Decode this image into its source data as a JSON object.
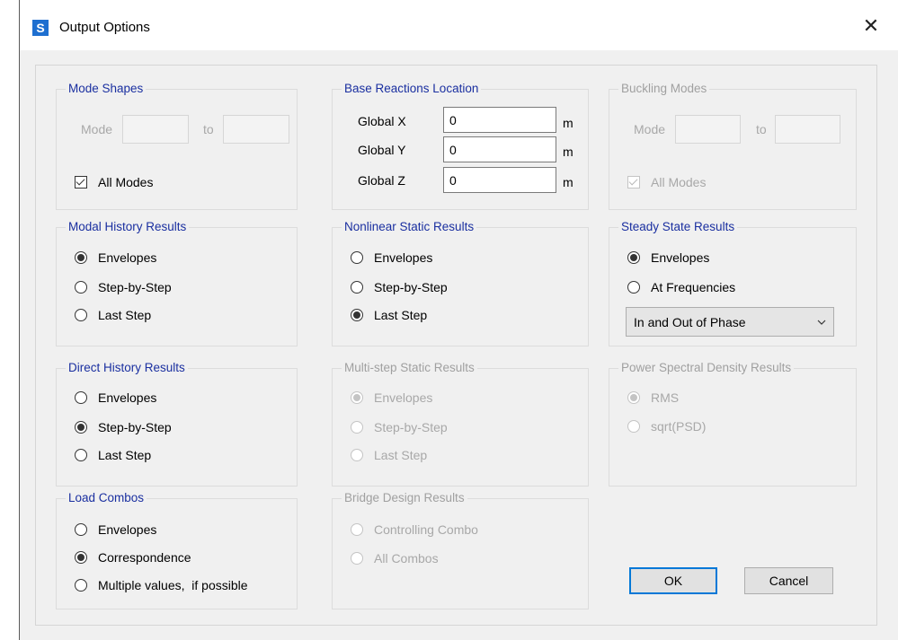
{
  "window": {
    "title": "Output Options",
    "app_icon_letter": "S",
    "close_glyph": "✕"
  },
  "mode_shapes": {
    "title": "Mode Shapes",
    "mode_label": "Mode",
    "to_label": "to",
    "all_modes_label": "All Modes",
    "all_modes_checked": true
  },
  "base_reactions": {
    "title": "Base Reactions Location",
    "rows": [
      {
        "label": "Global X",
        "value": "0",
        "unit": "m"
      },
      {
        "label": "Global Y",
        "value": "0",
        "unit": "m"
      },
      {
        "label": "Global Z",
        "value": "0",
        "unit": "m"
      }
    ]
  },
  "buckling_modes": {
    "title": "Buckling Modes",
    "mode_label": "Mode",
    "to_label": "to",
    "all_modes_label": "All Modes",
    "all_modes_checked": true
  },
  "modal_history": {
    "title": "Modal History Results",
    "options": [
      "Envelopes",
      "Step-by-Step",
      "Last Step"
    ],
    "selected": 0
  },
  "nonlinear_static": {
    "title": "Nonlinear Static Results",
    "options": [
      "Envelopes",
      "Step-by-Step",
      "Last Step"
    ],
    "selected": 2
  },
  "steady_state": {
    "title": "Steady State Results",
    "options": [
      "Envelopes",
      "At Frequencies"
    ],
    "selected": 0,
    "phase_select": "In and Out of Phase"
  },
  "direct_history": {
    "title": "Direct History Results",
    "options": [
      "Envelopes",
      "Step-by-Step",
      "Last Step"
    ],
    "selected": 1
  },
  "multistep_static": {
    "title": "Multi-step Static Results",
    "options": [
      "Envelopes",
      "Step-by-Step",
      "Last Step"
    ],
    "selected": 0
  },
  "psd": {
    "title": "Power Spectral Density Results",
    "options": [
      "RMS",
      "sqrt(PSD)"
    ],
    "selected": 0
  },
  "load_combos": {
    "title": "Load Combos",
    "options": [
      "Envelopes",
      "Correspondence",
      "Multiple values,  if possible"
    ],
    "selected": 1
  },
  "bridge_design": {
    "title": "Bridge Design Results",
    "options": [
      "Controlling Combo",
      "All Combos"
    ],
    "selected": -1
  },
  "buttons": {
    "ok": "OK",
    "cancel": "Cancel"
  }
}
